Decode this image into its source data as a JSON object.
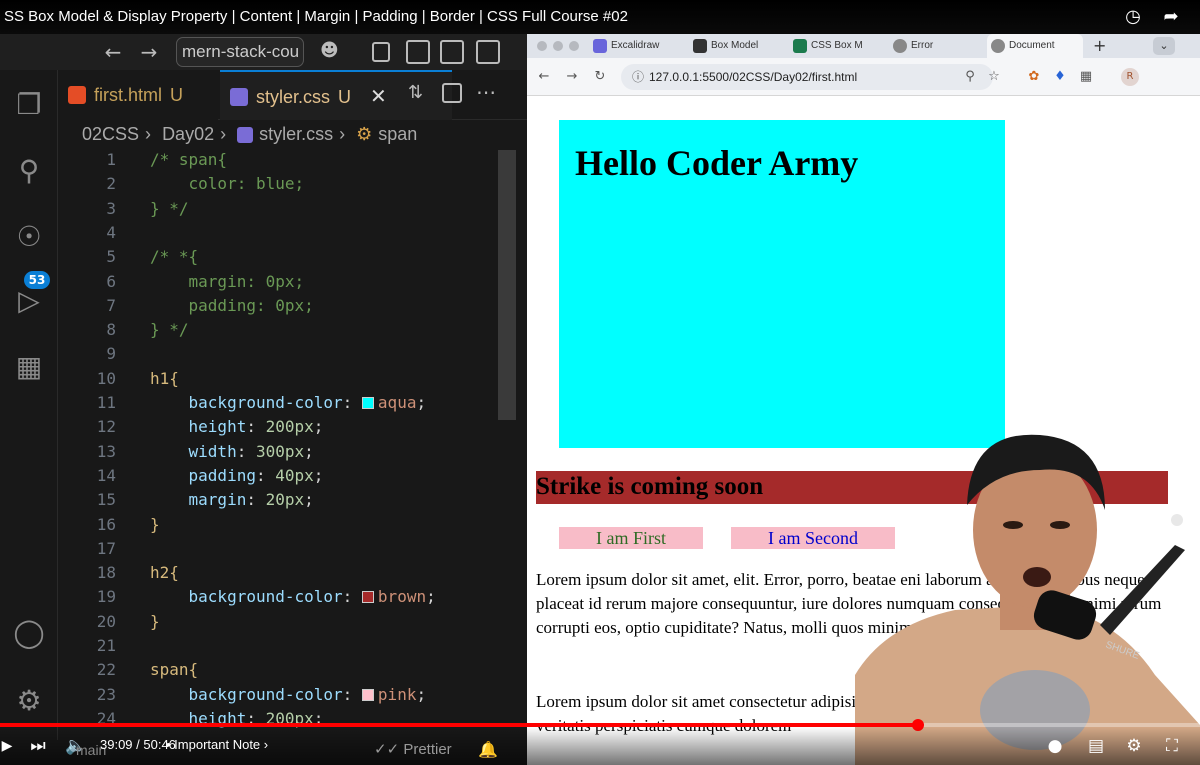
{
  "video": {
    "title": "SS Box Model & Display Property | Content | Margin | Padding | Border | CSS Full Course #02",
    "time": "39:09 / 50:46",
    "chapter": "Important Note",
    "progress_fraction": 0.765
  },
  "vscode": {
    "search_text": "mern-stack-cou",
    "tabs": [
      {
        "label": "first.html",
        "status": "U",
        "icon": "html-file-icon"
      },
      {
        "label": "styler.css",
        "status": "U",
        "icon": "css-file-icon",
        "active": true
      }
    ],
    "breadcrumb": [
      "02CSS",
      "Day02",
      "styler.css",
      "span"
    ],
    "scm_badge": "53",
    "status": {
      "branch": "main",
      "formatter": "Prettier"
    },
    "code_lines": [
      {
        "n": "1",
        "text": "/* span{"
      },
      {
        "n": "2",
        "text": "    color: blue;"
      },
      {
        "n": "3",
        "text": "} */"
      },
      {
        "n": "4",
        "text": ""
      },
      {
        "n": "5",
        "text": "/* *{"
      },
      {
        "n": "6",
        "text": "    margin: 0px;"
      },
      {
        "n": "7",
        "text": "    padding: 0px;"
      },
      {
        "n": "8",
        "text": "} */"
      },
      {
        "n": "9",
        "text": ""
      },
      {
        "n": "10",
        "sel": "h1{"
      },
      {
        "n": "11",
        "prop": "background-color",
        "val": "aqua",
        "swatch": "#00ffff"
      },
      {
        "n": "12",
        "prop": "height",
        "val": "200px"
      },
      {
        "n": "13",
        "prop": "width",
        "val": "300px"
      },
      {
        "n": "14",
        "prop": "padding",
        "val": "40px"
      },
      {
        "n": "15",
        "prop": "margin",
        "val": "20px"
      },
      {
        "n": "16",
        "sel": "}"
      },
      {
        "n": "17",
        "text": ""
      },
      {
        "n": "18",
        "sel": "h2{"
      },
      {
        "n": "19",
        "prop": "background-color",
        "val": "brown",
        "swatch": "#a52a2a"
      },
      {
        "n": "20",
        "sel": "}"
      },
      {
        "n": "21",
        "text": ""
      },
      {
        "n": "22",
        "sel": "span{"
      },
      {
        "n": "23",
        "prop": "background-color",
        "val": "pink",
        "swatch": "#ffc0cb"
      },
      {
        "n": "24",
        "prop": "height",
        "val": "200px"
      }
    ]
  },
  "browser": {
    "tabs": [
      "Excalidraw",
      "Box Model",
      "CSS Box M",
      "Error",
      "Document"
    ],
    "url": "127.0.0.1:5500/02CSS/Day02/first.html",
    "page": {
      "h1": "Hello Coder Army",
      "h2": "Strike is coming soon",
      "span1": "I am First",
      "span2": "I am Second",
      "para1": "Lorem ipsum dolor sit amet, elit. Error, porro, beatae eni laborum amet temporibus neque placeat id rerum majore consequuntur, iure dolores numquam consequatur odis animi rerum corrupti eos, optio cupiditate? Natus, molli quos minima facilis ullam?",
      "para2": "Lorem ipsum dolor sit amet consectetur adipisicing elit. Blanditiis voluptatem officiis veritatis perspiciatis cumque dolorem"
    }
  },
  "colors": {
    "aqua": "#00ffff",
    "brown": "#a52a2a",
    "pink": "#f8bcc8",
    "accent": "#0a7fd6",
    "progress": "#ff0000"
  }
}
